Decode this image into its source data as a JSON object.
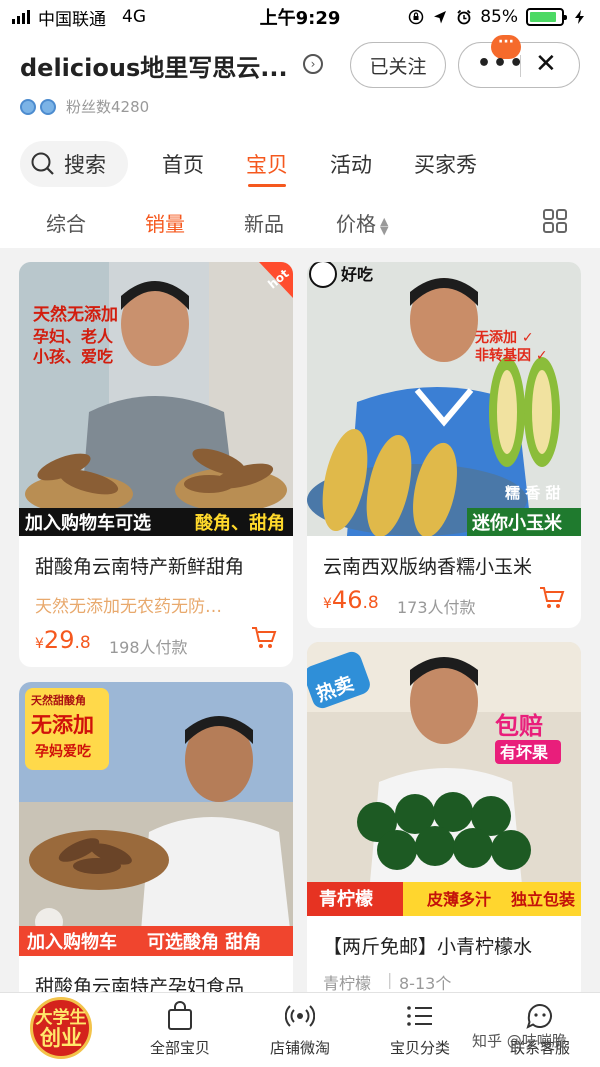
{
  "status_bar": {
    "carrier": "中国联通",
    "network": "4G",
    "time": "上午9:29",
    "battery": "85%",
    "battery_level": 0.85
  },
  "shop": {
    "name": "delicious地里写思云...",
    "fans": "粉丝数4280",
    "follow_label": "已关注",
    "more_badge": "···"
  },
  "nav_tabs": {
    "search": "搜索",
    "items": [
      "首页",
      "宝贝",
      "活动",
      "买家秀"
    ],
    "active": "宝贝"
  },
  "sort_bar": {
    "items": [
      "综合",
      "销量",
      "新品",
      "价格"
    ],
    "active": "销量"
  },
  "products": [
    {
      "title": "甜酸角云南特产新鲜甜角",
      "subtitle": "天然无添加无农药无防…",
      "price_int": "29",
      "price_dec": ".8",
      "sold": "198人付款",
      "img_badge": "hot",
      "img_texts": [
        "天然无添加",
        "孕妇、老人",
        "小孩、爱吃",
        "加入购物车可选",
        "酸角、甜角"
      ]
    },
    {
      "title": "云南西双版纳香糯小玉米",
      "price_int": "46",
      "price_dec": ".8",
      "sold": "173人付款",
      "img_texts": [
        "好吃",
        "无添加 ✓",
        "非转基因 ✓",
        "糯 香 甜",
        "迷你小玉米"
      ]
    },
    {
      "title": "甜酸角云南特产孕妇食品",
      "img_texts": [
        "天然甜酸角",
        "无添加",
        "孕妈爱吃",
        "加入购物车",
        "可选酸角 甜角"
      ]
    },
    {
      "title": "【两斤免邮】小青柠檬水",
      "tags": [
        "青柠檬",
        "8-13个"
      ],
      "img_texts": [
        "热卖",
        "包赔",
        "有坏果",
        "青柠檬",
        "皮薄多汁",
        "独立包装"
      ]
    }
  ],
  "bottom_nav": {
    "logo_lines": [
      "大学生",
      "创业"
    ],
    "items": [
      "全部宝贝",
      "店铺微淘",
      "宝贝分类",
      "联系客服"
    ]
  },
  "watermark": "知乎 @吱嘣脆",
  "colors": {
    "accent": "#f5581e",
    "price": "#f5581e",
    "subtitle": "#e8a96d"
  }
}
